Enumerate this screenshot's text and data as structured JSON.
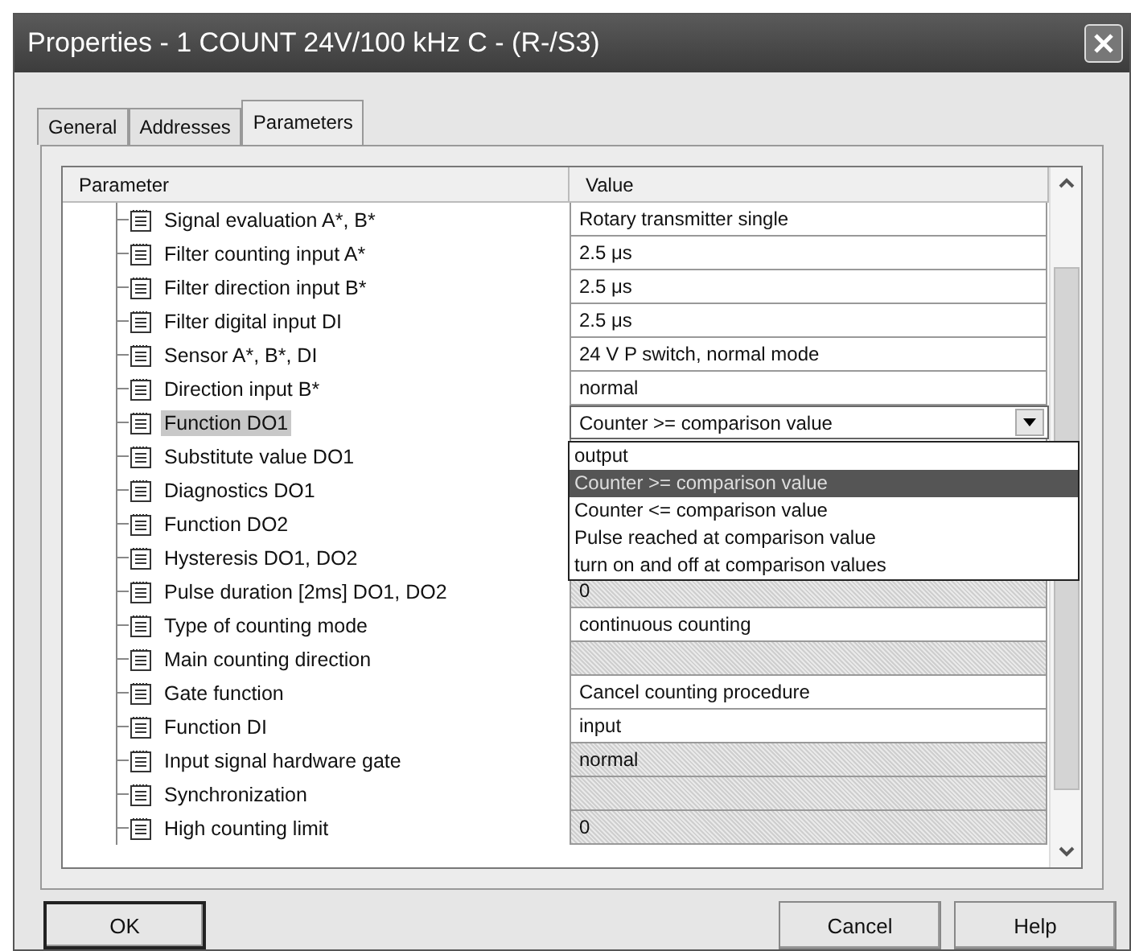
{
  "window": {
    "title": "Properties - 1 COUNT 24V/100 kHz C - (R-/S3)"
  },
  "tabs": [
    {
      "label": "General",
      "selected": false
    },
    {
      "label": "Addresses",
      "selected": false
    },
    {
      "label": "Parameters",
      "selected": true
    }
  ],
  "table": {
    "columns": [
      "Parameter",
      "Value"
    ],
    "rows": [
      {
        "name": "Signal evaluation A*, B*",
        "value": "Rotary transmitter single",
        "disabled": false,
        "selected": false,
        "kind": "text"
      },
      {
        "name": "Filter counting input A*",
        "value": "2.5 μs",
        "disabled": false,
        "selected": false,
        "kind": "text"
      },
      {
        "name": "Filter direction input B*",
        "value": "2.5 μs",
        "disabled": false,
        "selected": false,
        "kind": "text"
      },
      {
        "name": "Filter digital input DI",
        "value": "2.5 μs",
        "disabled": false,
        "selected": false,
        "kind": "text"
      },
      {
        "name": "Sensor A*, B*, DI",
        "value": "24 V P switch, normal mode",
        "disabled": false,
        "selected": false,
        "kind": "text"
      },
      {
        "name": "Direction input B*",
        "value": "normal",
        "disabled": false,
        "selected": false,
        "kind": "text"
      },
      {
        "name": "Function DO1",
        "value": "Counter >= comparison value",
        "selected": true,
        "kind": "dropdown",
        "expanded": true,
        "options": [
          {
            "label": "output",
            "selected": false
          },
          {
            "label": "Counter >= comparison value",
            "selected": true
          },
          {
            "label": "Counter <= comparison value",
            "selected": false
          },
          {
            "label": "Pulse reached at comparison value",
            "selected": false
          },
          {
            "label": "turn on and off at comparison values",
            "selected": false
          }
        ]
      },
      {
        "name": "Substitute value DO1",
        "selected": false,
        "kind": "text"
      },
      {
        "name": "Diagnostics DO1",
        "selected": false,
        "kind": "text"
      },
      {
        "name": "Function DO2",
        "selected": false,
        "kind": "text"
      },
      {
        "name": "Hysteresis DO1, DO2",
        "selected": false,
        "kind": "text"
      },
      {
        "name": "Pulse duration [2ms] DO1, DO2",
        "value": "0",
        "disabled": true,
        "selected": false,
        "kind": "text"
      },
      {
        "name": "Type of counting mode",
        "value": "continuous counting",
        "disabled": false,
        "selected": false,
        "kind": "text"
      },
      {
        "name": "Main counting direction",
        "disabled": true,
        "selected": false,
        "kind": "text"
      },
      {
        "name": "Gate function",
        "value": "Cancel counting procedure",
        "disabled": false,
        "selected": false,
        "kind": "text"
      },
      {
        "name": "Function DI",
        "value": "input",
        "disabled": false,
        "selected": false,
        "kind": "text"
      },
      {
        "name": "Input signal hardware gate",
        "value": "normal",
        "disabled": true,
        "selected": false,
        "kind": "text"
      },
      {
        "name": "Synchronization",
        "disabled": true,
        "selected": false,
        "kind": "text"
      },
      {
        "name": "High counting limit",
        "value": "0",
        "disabled": true,
        "selected": false,
        "kind": "text"
      }
    ]
  },
  "buttons": [
    {
      "label": "OK",
      "default": true
    },
    {
      "label": "Cancel",
      "default": false
    },
    {
      "label": "Help",
      "default": false
    }
  ]
}
